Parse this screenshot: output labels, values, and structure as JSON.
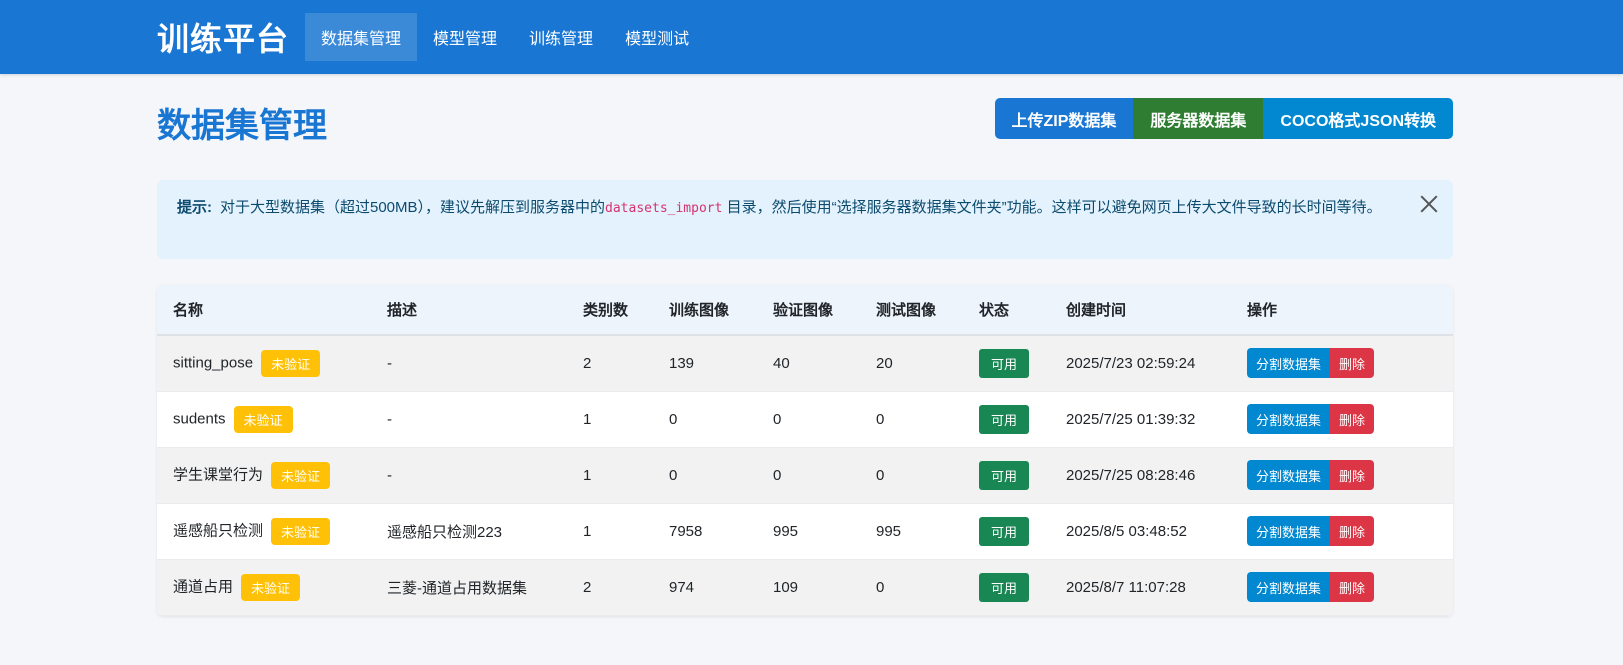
{
  "nav": {
    "brand": "训练平台",
    "items": [
      "数据集管理",
      "模型管理",
      "训练管理",
      "模型测试"
    ]
  },
  "page": {
    "title": "数据集管理",
    "buttons": {
      "upload_zip": "上传ZIP数据集",
      "server_dataset": "服务器数据集",
      "coco_convert": "COCO格式JSON转换"
    }
  },
  "alert": {
    "prefix": "提示:",
    "text_before": "对于大型数据集（超过500MB），建议先解压到服务器中的",
    "code": "datasets_import",
    "text_after": "目录，然后使用“选择服务器数据集文件夹”功能。这样可以避免网页上传大文件导致的长时间等待。"
  },
  "table": {
    "headers": [
      "名称",
      "描述",
      "类别数",
      "训练图像",
      "验证图像",
      "测试图像",
      "状态",
      "创建时间",
      "操作"
    ],
    "rows": [
      {
        "name": "sitting_pose",
        "badge": "未验证",
        "desc": "-",
        "classes": "2",
        "train": "139",
        "val": "40",
        "test": "20",
        "status": "可用",
        "created": "2025/7/23 02:59:24"
      },
      {
        "name": "sudents",
        "badge": "未验证",
        "desc": "-",
        "classes": "1",
        "train": "0",
        "val": "0",
        "test": "0",
        "status": "可用",
        "created": "2025/7/25 01:39:32"
      },
      {
        "name": "学生课堂行为",
        "badge": "未验证",
        "desc": "-",
        "classes": "1",
        "train": "0",
        "val": "0",
        "test": "0",
        "status": "可用",
        "created": "2025/7/25 08:28:46"
      },
      {
        "name": "遥感船只检测",
        "badge": "未验证",
        "desc": "遥感船只检测223",
        "classes": "1",
        "train": "7958",
        "val": "995",
        "test": "995",
        "status": "可用",
        "created": "2025/8/5 03:48:52"
      },
      {
        "name": "通道占用",
        "badge": "未验证",
        "desc": "三菱-通道占用数据集",
        "classes": "2",
        "train": "974",
        "val": "109",
        "test": "0",
        "status": "可用",
        "created": "2025/8/7 11:07:28"
      }
    ],
    "actions": {
      "split": "分割数据集",
      "delete": "删除"
    }
  }
}
